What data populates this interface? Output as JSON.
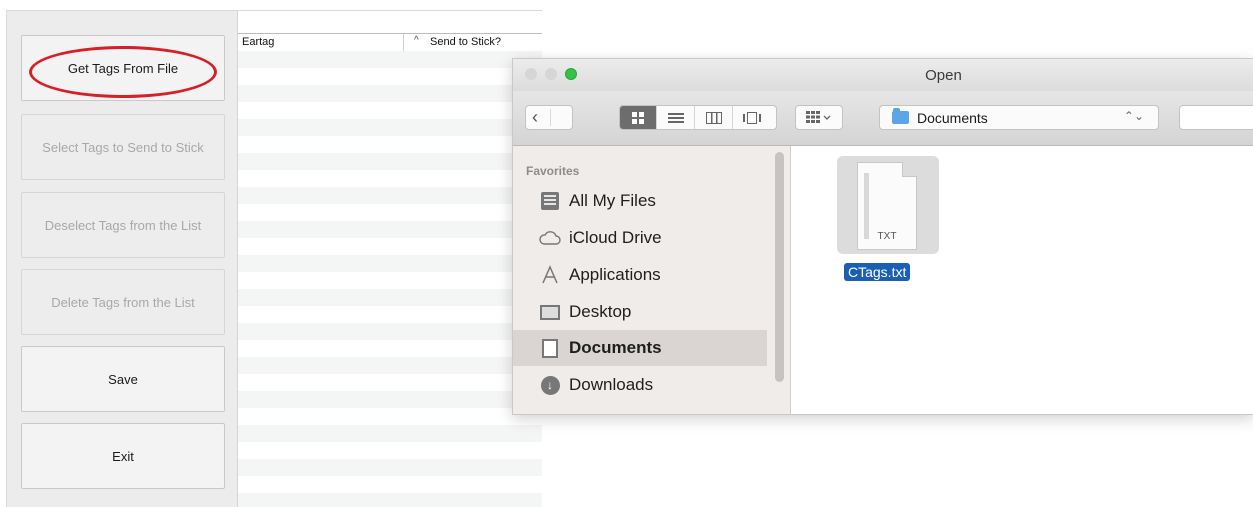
{
  "app": {
    "buttons": {
      "get_tags": "Get Tags From File",
      "select_tags": "Select Tags to Send to Stick",
      "deselect_tags": "Deselect Tags from the List",
      "delete_tags": "Delete Tags from the List",
      "save": "Save",
      "exit": "Exit"
    },
    "list": {
      "columns": [
        "Eartag",
        "Send to Stick?"
      ],
      "sort_indicator": "^"
    }
  },
  "dialog": {
    "title": "Open",
    "location": "Documents",
    "sidebar": {
      "heading": "Favorites",
      "items": [
        "All My Files",
        "iCloud Drive",
        "Applications",
        "Desktop",
        "Documents",
        "Downloads"
      ],
      "selected": "Documents"
    },
    "file": {
      "name": "CTags.txt",
      "extension": "TXT"
    },
    "icons": {
      "back": "chevron-left-icon",
      "view_modes": [
        "icon-view-icon",
        "list-view-icon",
        "column-view-icon",
        "coverflow-view-icon"
      ],
      "arrange": "arrange-icon"
    }
  }
}
